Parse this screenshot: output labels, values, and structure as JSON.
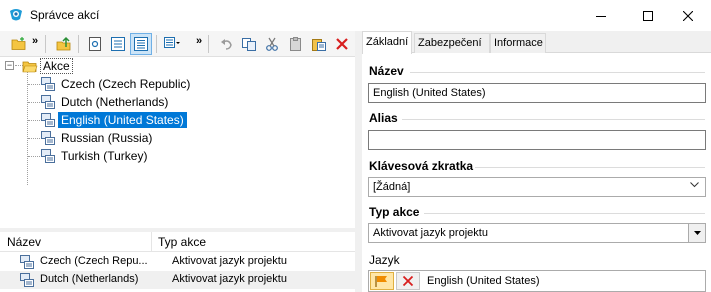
{
  "window": {
    "title": "Správce akcí",
    "icons": [
      "app-icon",
      "minimize-icon",
      "maximize-icon",
      "close-icon"
    ]
  },
  "toolbar": {
    "icons": [
      "new-folder-icon",
      "overflow-chevron-icon",
      "move-up-icon",
      "view-preview-icon",
      "view-list-icon",
      "view-details-icon",
      "layout-icon",
      "overflow-chevron-icon",
      "undo-icon",
      "copy-icon",
      "cut-icon",
      "paste-icon",
      "paste-special-icon",
      "delete-icon"
    ]
  },
  "tree": {
    "root": "Akce",
    "items": [
      {
        "label": "Czech (Czech Republic)"
      },
      {
        "label": "Dutch (Netherlands)"
      },
      {
        "label": "English (United States)",
        "selected": true
      },
      {
        "label": "Russian (Russia)"
      },
      {
        "label": "Turkish (Turkey)"
      }
    ]
  },
  "list": {
    "columns": [
      "Název",
      "Typ akce"
    ],
    "rows": [
      {
        "name": "Czech (Czech Repu...",
        "type": "Aktivovat jazyk projektu"
      },
      {
        "name": "Dutch (Netherlands)",
        "type": "Aktivovat jazyk projektu"
      }
    ]
  },
  "tabs": [
    "Základní",
    "Zabezpečení",
    "Informace"
  ],
  "form": {
    "name_label": "Název",
    "name_value": "English (United States)",
    "alias_label": "Alias",
    "alias_value": "",
    "shortcut_label": "Klávesová zkratka",
    "shortcut_value": "[Žádná]",
    "action_type_label": "Typ akce",
    "action_type_value": "Aktivovat jazyk projektu",
    "language_label": "Jazyk",
    "language_value": "English (United States)"
  },
  "colors": {
    "selection": "#0078d7",
    "delete_red": "#d81e1e",
    "flag_orange": "#f08c00"
  }
}
